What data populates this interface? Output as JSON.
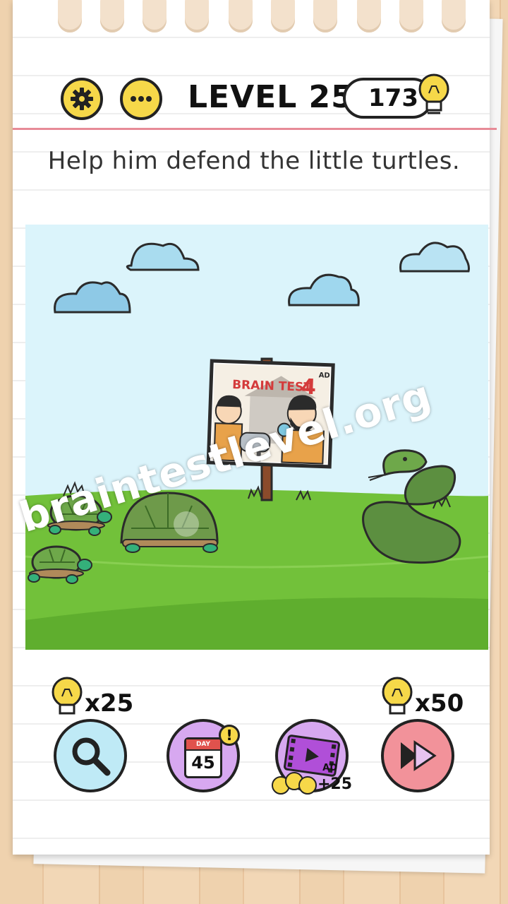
{
  "header": {
    "level_label": "LEVEL 259",
    "hint_count": "173",
    "settings_icon": "gear-icon",
    "menu_icon": "ellipsis-icon"
  },
  "question": "Help him defend the little turtles.",
  "scene": {
    "billboard": {
      "title": "BRAIN TEST",
      "number": "4",
      "badge": "AD"
    }
  },
  "watermark": "braintestlevel.org",
  "toolbar": {
    "search_cost": "x25",
    "skip_cost": "x50",
    "day_label": "DAY",
    "day_number": "45",
    "day_alert": "!",
    "video_badge": "AD",
    "video_reward": "+25"
  },
  "colors": {
    "accent_yellow": "#f6d849",
    "sky": "#dbf4fb",
    "grass": "#72c13a",
    "search_bg": "#bfeaf6",
    "calendar_bg": "#d7a8f0",
    "skip_bg": "#f2929a"
  }
}
